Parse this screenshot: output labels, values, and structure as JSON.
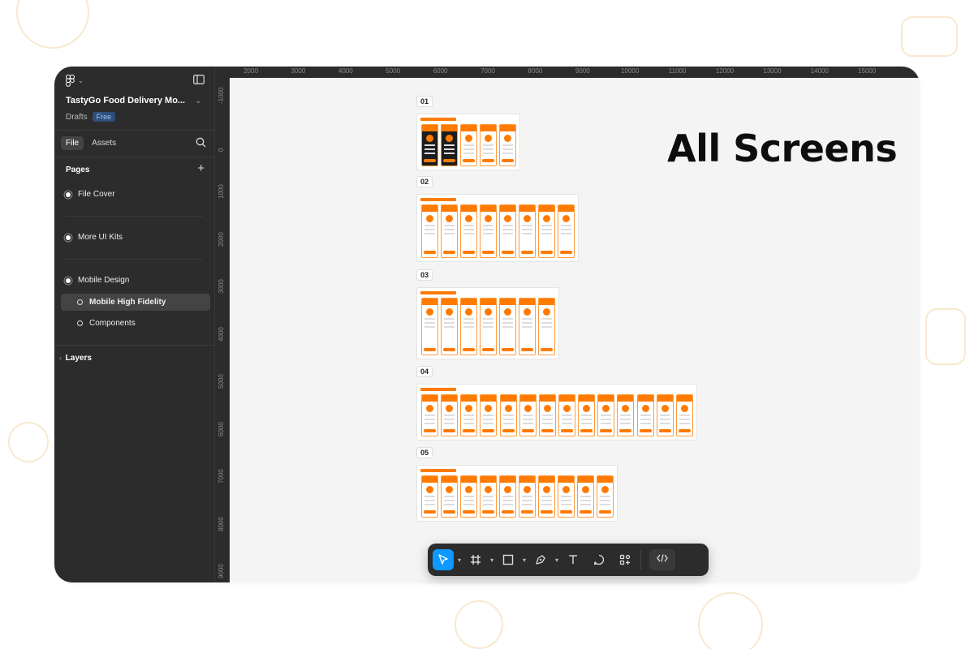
{
  "file": {
    "title": "TastyGo Food Delivery Mo...",
    "location": "Drafts",
    "plan_badge": "Free"
  },
  "tabs": {
    "file": "File",
    "assets": "Assets"
  },
  "pages": {
    "heading": "Pages",
    "items": [
      "File Cover",
      "More UI Kits",
      "Mobile Design"
    ],
    "sub_items": [
      "Mobile High Fidelity",
      "Components"
    ],
    "selected_sub_item": "Mobile High Fidelity"
  },
  "layers_heading": "Layers",
  "ruler_x": [
    "2000",
    "3000",
    "4000",
    "5000",
    "6000",
    "7000",
    "8000",
    "9000",
    "10000",
    "11000",
    "12000",
    "13000",
    "14000",
    "15000"
  ],
  "ruler_y": [
    "-1000",
    "0",
    "1000",
    "2000",
    "3000",
    "4000",
    "5000",
    "6000",
    "7000",
    "8000",
    "9000"
  ],
  "sections": [
    "01",
    "02",
    "03",
    "04",
    "05"
  ],
  "headline": "All Screens",
  "toolbar": {
    "tools": [
      "move-tool",
      "frame-tool",
      "rectangle-tool",
      "pen-tool",
      "text-tool",
      "comment-tool",
      "actions-tool",
      "dev-mode-toggle"
    ],
    "active_tool": "move-tool"
  },
  "colors": {
    "sidebar": "#2c2c2c",
    "canvas": "#f4f4f5",
    "accent": "#0d99ff",
    "brand_orange": "#ff7a00"
  }
}
